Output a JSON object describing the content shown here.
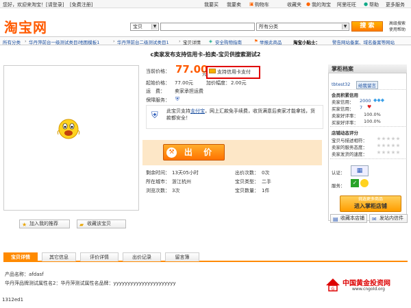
{
  "topbar": {
    "welcome": "您好，欢迎来淘宝！[请登录]",
    "register": "[免费注册]",
    "links": [
      "我要买",
      "我要卖",
      "购物车",
      "收藏夹",
      "我的淘宝",
      "阿里旺旺",
      "帮助",
      "更多服务"
    ]
  },
  "logo": "淘宝网",
  "search": {
    "scope": "宝贝",
    "query": "",
    "category": "所有分类",
    "button": "搜 索",
    "adv": [
      "高级搜索",
      "使用帮助"
    ]
  },
  "nav": {
    "breadcrumb": [
      "所有分类",
      "华丹萍前台一级测试类目i地图模板1",
      "华丹萍前台二级测试类目1",
      "宝贝详情"
    ],
    "links": [
      "安全购物指南",
      "举报此商品"
    ],
    "tip_label": "淘宝小贴士：",
    "tip_text": "警告网站备案、域名备案等网站"
  },
  "item": {
    "title": "c卖家发布支持信用卡-拍卖-宝贝供搜索测试2",
    "price_label": "当前价格：",
    "price": "77.00",
    "price_unit": "元",
    "credit_card": "支持信用卡支付",
    "start_price_label": "起始价格：",
    "start_price": "77.00元",
    "increment_label": "加价幅度：",
    "increment": "2.00元",
    "shipping_label": "运　费：",
    "shipping": "卖家承担运费",
    "guarantee_label": "保障服务：",
    "alipay_notice_prefix": "此宝贝支持",
    "alipay_link": "支付宝",
    "alipay_notice_rest": "，网上汇款免手续费，收货满意后卖家才能拿钱，货款都安全！",
    "bid_button": "出 价"
  },
  "stats": {
    "time_left_label": "剩余时间：",
    "time_left": "13天05小时",
    "bids_label": "出价次数：",
    "bids": "0次",
    "city_label": "所在城市：",
    "city": "浙江杭州",
    "type_label": "宝贝类型：",
    "type": "二手",
    "views_label": "浏览次数：",
    "views": "3次",
    "qty_label": "宝贝数量：",
    "qty": "1件"
  },
  "actions": {
    "recommend": "加入我的推荐",
    "favorite": "收藏该宝贝"
  },
  "seller": {
    "panel_title": "掌柜档案",
    "name": "tbtest32",
    "contact": "给我留言",
    "credit_title": "会员积累信用",
    "seller_credit_label": "卖家信用：",
    "seller_credit": "2000",
    "buyer_credit_label": "买家信用：",
    "buyer_credit": "7",
    "seller_rate_label": "卖家好评率：",
    "seller_rate": "100.0%",
    "buyer_rate_label": "买家好评率：",
    "buyer_rate": "100.0%",
    "dynamic_title": "店铺动态评分",
    "dyn": [
      "宝贝与描述相符：",
      "卖家的服务态度：",
      "卖家发货的速度："
    ],
    "cert_label": "认证：",
    "service_label": "服务：",
    "shop_banner_top": "挑选更多商品",
    "shop_banner": "进入掌柜店铺",
    "fav_shop": "收藏本店铺",
    "send_msg": "发站内信件"
  },
  "tabs": [
    "宝贝详情",
    "其它信息",
    "评价详情",
    "出价记录",
    "留言簿"
  ],
  "details": {
    "name_label": "产品名称：",
    "name": "afdasf",
    "attr": "华丹萍品牌测试属性名2：华丹萍测试属性名品牌：yyyyyyyyyyyyyyyyyyyyyy"
  },
  "footer_code": "1312ed1",
  "watermark": {
    "cn": "中国黄金投资网",
    "url": "www.cngold.org"
  }
}
